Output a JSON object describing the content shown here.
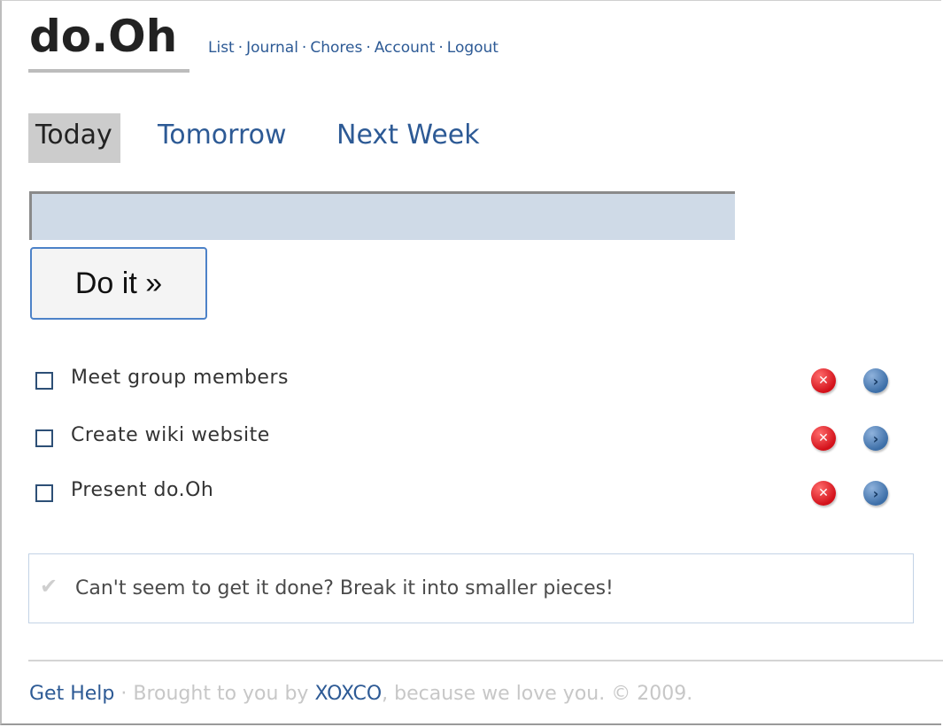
{
  "app": {
    "logo": "do.Oh"
  },
  "topnav": {
    "items": [
      "List",
      "Journal",
      "Chores",
      "Account",
      "Logout"
    ],
    "separator": "·"
  },
  "tabs": [
    {
      "label": "Today",
      "active": true
    },
    {
      "label": "Tomorrow",
      "active": false
    },
    {
      "label": "Next Week",
      "active": false
    }
  ],
  "task_input": {
    "value": "",
    "placeholder": ""
  },
  "submit_button": {
    "label": "Do it »"
  },
  "tasks": [
    {
      "label": "Meet group members",
      "checked": false
    },
    {
      "label": "Create wiki website",
      "checked": false
    },
    {
      "label": "Present do.Oh",
      "checked": false
    }
  ],
  "task_actions": {
    "delete_icon": "x-icon",
    "next_icon": "chevron-right-icon"
  },
  "tip": {
    "icon": "checkmark-icon",
    "text": "Can't seem to get it done? Break it into smaller pieces!"
  },
  "footer": {
    "help_link": "Get Help",
    "separator": "·",
    "brought_text": "Brought to you by",
    "company_link": "XOXCO",
    "tail_text": ", because we love you. © 2009."
  },
  "colors": {
    "link": "#2d5a95",
    "active_tab_bg": "#cccccc",
    "input_bg": "#cfdae7",
    "button_border": "#4d82c8",
    "delete": "#d3111a",
    "next": "#3d6fa8"
  }
}
